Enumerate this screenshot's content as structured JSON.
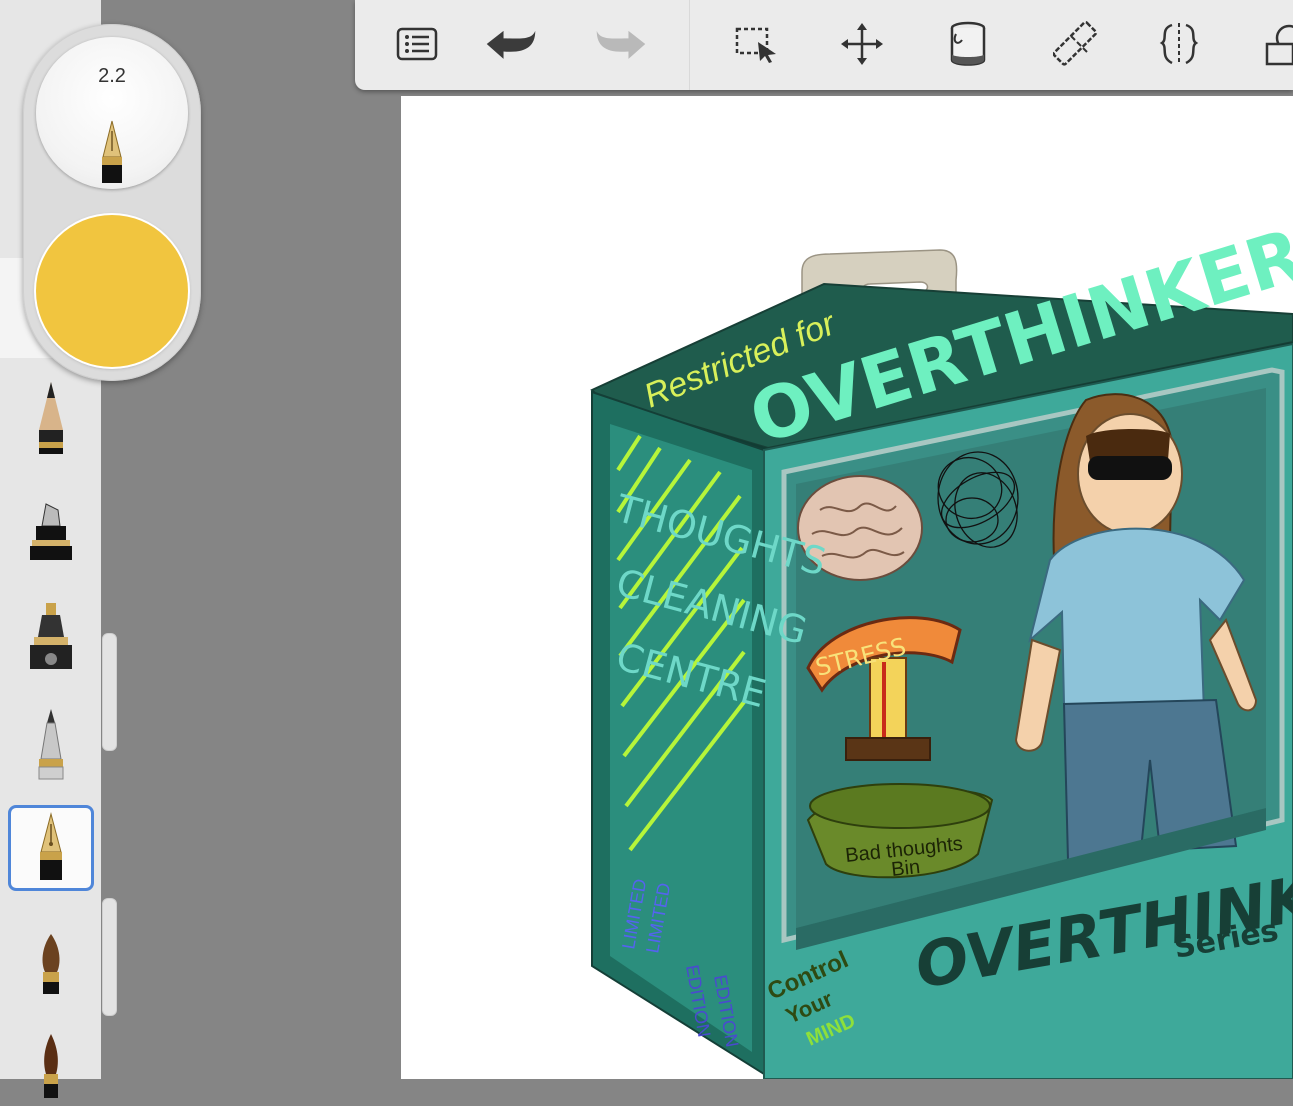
{
  "brush_size": "2.2",
  "current_color": "#f1c53f",
  "accent_color": "#4f86d9",
  "brushes": [
    {
      "name": "pencil",
      "selected": false
    },
    {
      "name": "marker",
      "selected": false
    },
    {
      "name": "airbrush",
      "selected": false
    },
    {
      "name": "ballpoint",
      "selected": false
    },
    {
      "name": "fountain-pen",
      "selected": true
    },
    {
      "name": "paintbrush",
      "selected": false
    },
    {
      "name": "fine-paintbrush",
      "selected": false
    }
  ],
  "toolbar": {
    "tools": [
      "list-icon",
      "undo-icon",
      "redo-icon",
      "selection-icon",
      "transform-icon",
      "fill-icon",
      "ruler-icon",
      "symmetry-icon",
      "shapes-icon"
    ]
  },
  "artwork": {
    "top_small": "Restricted for",
    "top_large": "OVERTHINKER",
    "side_lines": [
      "THOUGHTS",
      "CLEANING",
      "CENTRE"
    ],
    "side_limited": [
      "LIMITED",
      "LIMITED"
    ],
    "side_edition": [
      "EDITION",
      "EDITION"
    ],
    "stress_label": "STRESS",
    "bin_lines": [
      "Bad thoughts",
      "Bin"
    ],
    "series_title": "OVERTHINKING",
    "series_sub": "Series",
    "slogan": [
      "Control",
      "Your",
      "MIND"
    ]
  }
}
